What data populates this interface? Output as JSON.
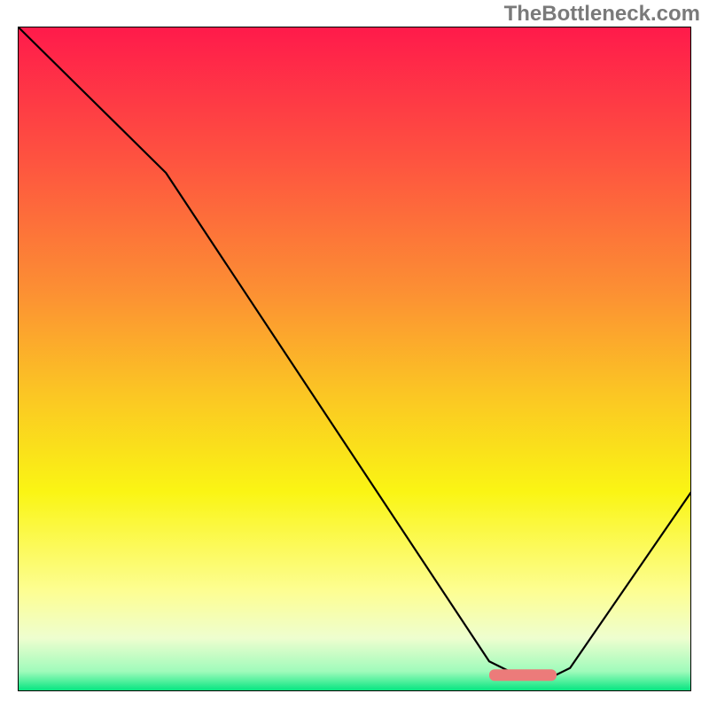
{
  "watermark": "TheBottleneck.com",
  "chart_data": {
    "type": "line",
    "title": "",
    "xlabel": "",
    "ylabel": "",
    "xlim": [
      0,
      100
    ],
    "ylim": [
      0,
      100
    ],
    "grid": false,
    "legend": false,
    "background_gradient": {
      "stops": [
        {
          "offset": 0.0,
          "color": "#ff1a4b"
        },
        {
          "offset": 0.2,
          "color": "#fe5340"
        },
        {
          "offset": 0.4,
          "color": "#fc9033"
        },
        {
          "offset": 0.55,
          "color": "#fbc524"
        },
        {
          "offset": 0.7,
          "color": "#faf514"
        },
        {
          "offset": 0.85,
          "color": "#fdfe93"
        },
        {
          "offset": 0.92,
          "color": "#eefecf"
        },
        {
          "offset": 0.97,
          "color": "#a0fbbb"
        },
        {
          "offset": 1.0,
          "color": "#00e47e"
        }
      ]
    },
    "series": [
      {
        "name": "bottleneck-curve",
        "x": [
          0,
          22,
          70,
          74,
          80,
          82,
          100
        ],
        "values": [
          100,
          78,
          4.5,
          2.5,
          2.5,
          3.5,
          30
        ]
      }
    ],
    "marker": {
      "name": "optimal-range",
      "x_start": 70,
      "x_end": 80,
      "y": 2.5,
      "color": "#ec7b7a"
    }
  }
}
